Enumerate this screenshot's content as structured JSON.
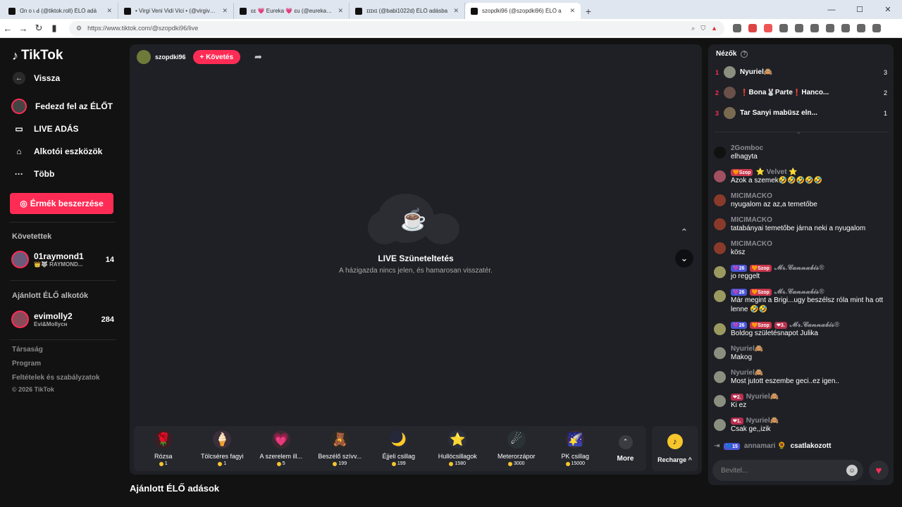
{
  "browser": {
    "tabs": [
      {
        "title": "Ɑn o ɩ ꓒ (@tiktok.roll) ÉLŐ adá"
      },
      {
        "title": "• Virgi Veni Vidi Vici • (@virgivenivid"
      },
      {
        "title": "ɛɛ 💗 Eureka 💗 ɛu (@eurekaeurek"
      },
      {
        "title": "ɪɪɪxɪ (@babi1022d) ÉLŐ adásba"
      },
      {
        "title": "szopdki96 (@szopdki96) ÉLŐ a"
      }
    ],
    "new_tab": "+",
    "url": "https://www.tiktok.com/@szopdki96/live"
  },
  "sidebar": {
    "logo": "TikTok",
    "back": "Vissza",
    "nav": [
      {
        "label": "Fedezd fel az ÉLŐT"
      },
      {
        "label": "LIVE ADÁS"
      },
      {
        "label": "Alkotói eszközök"
      },
      {
        "label": "Több"
      }
    ],
    "coin_button": "Érmék beszerzése",
    "following_label": "Követettek",
    "following": [
      {
        "name": "01raymond1",
        "sub": "👑🐺 RAYMOND...",
        "count": "14"
      }
    ],
    "recommended_label": "Ajánlott ÉLŐ alkotók",
    "recommended": [
      {
        "name": "evimolly2",
        "sub": "Evi&Mollycн",
        "count": "284"
      }
    ],
    "footer": [
      "Társaság",
      "Program",
      "Feltételek és szabályzatok",
      "© 2026 TikTok"
    ]
  },
  "stream": {
    "host": "szopdki96",
    "follow": "+ Követés",
    "pause_title": "LIVE Szüneteltetés",
    "pause_sub": "A házigazda nincs jelen, és hamarosan visszatér.",
    "gifts": [
      {
        "name": "Rózsa",
        "price": "1",
        "icon": "🌹"
      },
      {
        "name": "Tölcséres fagyi",
        "price": "1",
        "icon": "🍦"
      },
      {
        "name": "A szerelem ill...",
        "price": "5",
        "icon": "💗"
      },
      {
        "name": "Beszélő szívv...",
        "price": "199",
        "icon": "🧸"
      },
      {
        "name": "Éjjeli csillag",
        "price": "199",
        "icon": "🌙"
      },
      {
        "name": "Hullócsillagok",
        "price": "1580",
        "icon": "⭐"
      },
      {
        "name": "Meterorzápor",
        "price": "3000",
        "icon": "☄"
      },
      {
        "name": "PK csillag",
        "price": "15000",
        "icon": "🌠"
      }
    ],
    "more": "More",
    "recharge": "Recharge ^",
    "suggest_heading": "Ajánlott ÉLŐ adások"
  },
  "panel": {
    "viewers_label": "Nézők",
    "viewers": [
      {
        "rank": "1",
        "name": "Nyuriel🙈",
        "count": "3"
      },
      {
        "rank": "2",
        "name": "❗Bona🐰Parte❗Hanco...",
        "count": "2"
      },
      {
        "rank": "3",
        "name": "Tar Sanyi mabüsz eln...",
        "count": "1"
      }
    ],
    "messages": [
      {
        "user": "2Gomboc",
        "badges": [],
        "text": "elhagyta"
      },
      {
        "user": "⭐ Velvet ⭐",
        "badges": [
          {
            "t": "🧡Szop",
            "c": "b-red"
          }
        ],
        "text": "Azok a szemek🤣🤣🤣🤣🤣"
      },
      {
        "user": "MICIMACKO",
        "badges": [],
        "text": "nyugalom az az,a temetőbe"
      },
      {
        "user": "MICIMACKO",
        "badges": [],
        "text": "tatabányai temetőbe járna neki a nyugalom"
      },
      {
        "user": "MICIMACKO",
        "badges": [],
        "text": "kösz"
      },
      {
        "user": "𝓜𝓻.𝓒𝓪𝓷𝓷𝓪𝓫𝓲𝓼®",
        "badges": [
          {
            "t": "💜26",
            "c": "b-blue"
          },
          {
            "t": "🧡Szop",
            "c": "b-red"
          }
        ],
        "text": "jo reggelt"
      },
      {
        "user": "𝓜𝓻.𝓒𝓪𝓷𝓷𝓪𝓫𝓲𝓼®",
        "badges": [
          {
            "t": "💜26",
            "c": "b-blue"
          },
          {
            "t": "🧡Szop",
            "c": "b-red"
          }
        ],
        "text": "Már megint a Brigi...ugy beszélsz róla mint ha ott lenne 🤣🤣"
      },
      {
        "user": "𝓜𝓻.𝓒𝓪𝓷𝓷𝓪𝓫𝓲𝓼®",
        "badges": [
          {
            "t": "💜26",
            "c": "b-blue"
          },
          {
            "t": "🧡Szop",
            "c": "b-red"
          },
          {
            "t": "❤3.",
            "c": "b-pink"
          }
        ],
        "text": "Boldog születésnapot Julika"
      },
      {
        "user": "Nyuriel🙈",
        "badges": [],
        "text": "Makog"
      },
      {
        "user": "Nyuriel🙈",
        "badges": [],
        "text": "Most jutott eszembe geci..ez igen.."
      },
      {
        "user": "Nyuriel🙈",
        "badges": [
          {
            "t": "❤2.",
            "c": "b-pink"
          }
        ],
        "text": "Ki ez"
      },
      {
        "user": "Nyuriel🙈",
        "badges": [
          {
            "t": "❤1.",
            "c": "b-pink"
          }
        ],
        "text": "Csak ge,,izik"
      }
    ],
    "joined": {
      "badge": "💙15",
      "name": "annamari 🌻",
      "text": "csatlakozott"
    },
    "input_placeholder": "Bevitel..."
  }
}
